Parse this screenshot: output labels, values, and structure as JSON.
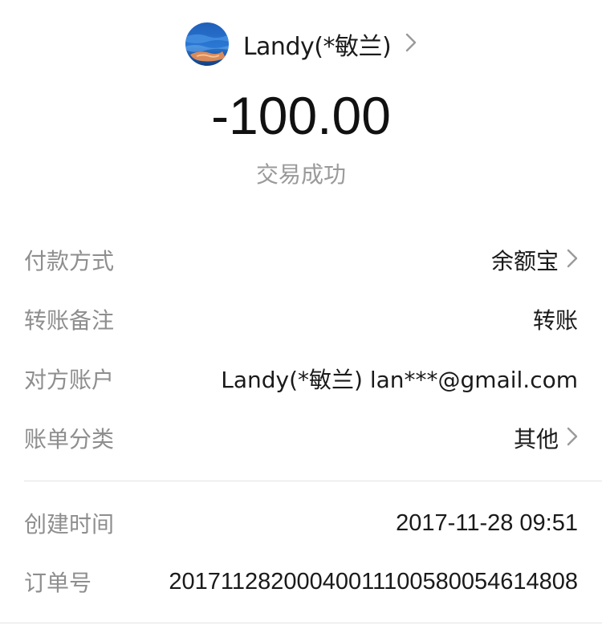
{
  "header": {
    "payee_name": "Landy(*敏兰)",
    "avatar_icon": "avatar-image",
    "chevron_icon": "chevron-right-icon"
  },
  "transaction": {
    "amount": "-100.00",
    "status": "交易成功"
  },
  "details": [
    {
      "label": "付款方式",
      "value": "余额宝",
      "has_chevron": true
    },
    {
      "label": "转账备注",
      "value": "转账",
      "has_chevron": false
    },
    {
      "label": "对方账户",
      "value": "Landy(*敏兰) lan***@gmail.com",
      "has_chevron": false
    },
    {
      "label": "账单分类",
      "value": "其他",
      "has_chevron": true
    }
  ],
  "meta": [
    {
      "label": "创建时间",
      "value": "2017-11-28 09:51"
    },
    {
      "label": "订单号",
      "value": "20171128200040011100580054614808"
    }
  ],
  "colors": {
    "label_gray": "#8e8e8e",
    "status_gray": "#9a9a9a",
    "text_dark": "#1a1a1a",
    "divider": "#e3e3e3"
  }
}
